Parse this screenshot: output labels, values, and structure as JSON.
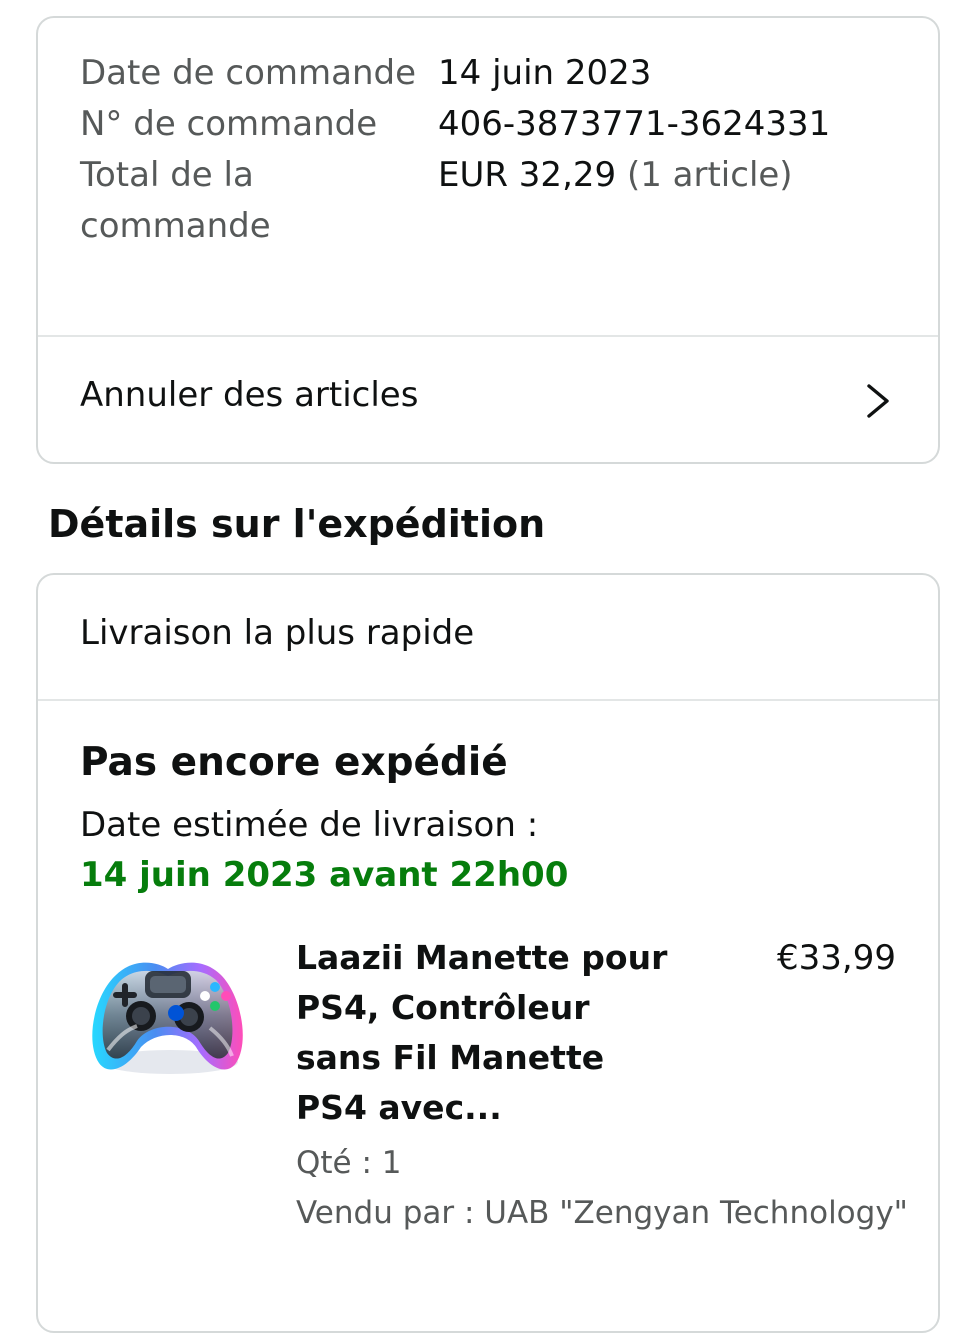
{
  "order": {
    "date_label": "Date de commande",
    "date_value": "14 juin 2023",
    "number_label": "N° de commande",
    "number_value": "406-3873771-3624331",
    "total_label": "Total de la commande",
    "total_amount": "EUR 32,29",
    "total_items": "(1 article)",
    "cancel_label": "Annuler des articles",
    "cancel_icon": "chevron-right-icon"
  },
  "shipping": {
    "section_title": "Détails sur l'expédition",
    "delivery_type": "Livraison la plus rapide",
    "status": "Pas encore expédié",
    "estimate_label": "Date estimée de livraison :",
    "estimate_date": "14 juin 2023 avant 22h00",
    "estimate_color": "#067d0c"
  },
  "product": {
    "image": "game-controller-image",
    "title": "Laazii Manette pour PS4, Contrôleur sans Fil Manette PS4 avec...",
    "price": "€33,99",
    "quantity": "Qté : 1",
    "seller": "Vendu par : UAB \"Zengyan Technology\""
  }
}
